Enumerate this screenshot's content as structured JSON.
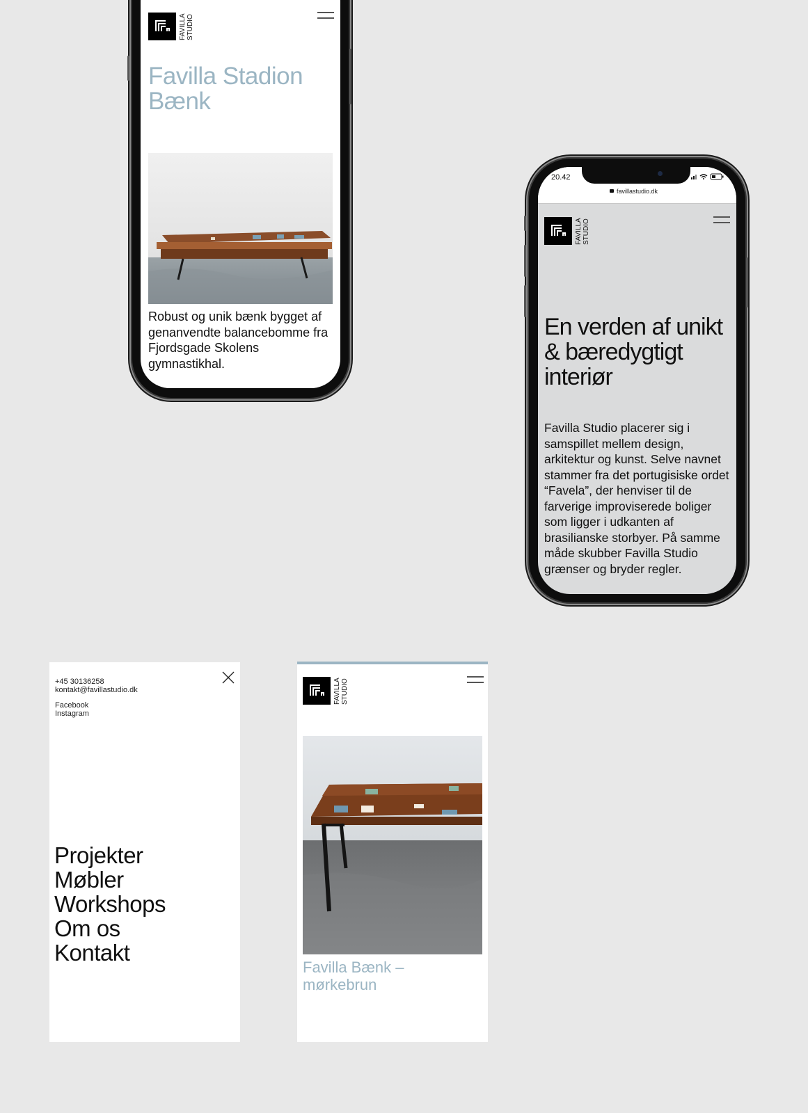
{
  "phone_product": {
    "title": "Favilla Stadion Bænk",
    "title_line1": "Favilla Stadion",
    "title_line2": "Bænk",
    "description": "Robust og unik bænk bygget af genanvendte balancebomme fra Fjordsgade Skolens gymnastikhal.",
    "image_icon": "bench-photo"
  },
  "phone_about": {
    "status_time": "20.42",
    "url": "favillastudio.dk",
    "heading": "En verden af unikt & bæredygtigt interiør",
    "body": "Favilla Studio placerer sig i samspillet mellem design, arkitektur og kunst. Selve navnet stammer fra det portugisiske ordet “Favela”, der henviser til de farverige improviserede boliger som ligger i udkanten af brasilianske storbyer. På samme måde skubber Favilla Studio grænser og bryder regler."
  },
  "brand": {
    "logo_line1": "FAVILLA",
    "logo_line2": "STUDIO"
  },
  "menu_panel": {
    "phone": "+45 30136258",
    "email": "kontakt@favillastudio.dk",
    "facebook": "Facebook",
    "instagram": "Instagram",
    "nav": [
      "Projekter",
      "Møbler",
      "Workshops",
      "Om os",
      "Kontakt"
    ]
  },
  "product_panel": {
    "title": "Favilla Bænk – mørkebrun"
  },
  "colors": {
    "background": "#e8e8e8",
    "accent": "#9bb5c3",
    "about_screen": "#dadbdc"
  }
}
